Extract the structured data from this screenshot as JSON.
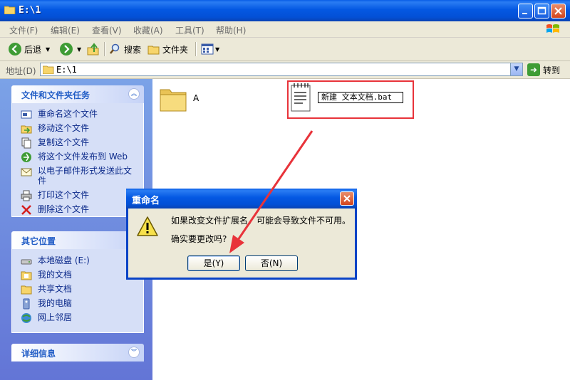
{
  "window": {
    "title": "E:\\1"
  },
  "menu": [
    "文件(F)",
    "编辑(E)",
    "查看(V)",
    "收藏(A)",
    "工具(T)",
    "帮助(H)"
  ],
  "toolbar": {
    "back": "后退",
    "search": "搜索",
    "folders": "文件夹"
  },
  "address": {
    "label": "地址(D)",
    "value": "E:\\1",
    "go": "转到"
  },
  "tasks": {
    "title": "文件和文件夹任务",
    "items": [
      "重命名这个文件",
      "移动这个文件",
      "复制这个文件",
      "将这个文件发布到 Web",
      "以电子邮件形式发送此文件",
      "打印这个文件",
      "删除这个文件"
    ]
  },
  "places": {
    "title": "其它位置",
    "items": [
      "本地磁盘 (E:)",
      "我的文档",
      "共享文档",
      "我的电脑",
      "网上邻居"
    ]
  },
  "details": {
    "title": "详细信息"
  },
  "files": {
    "folder_name": "A",
    "rename_value": "新建 文本文档.bat"
  },
  "dialog": {
    "title": "重命名",
    "message1": "如果改变文件扩展名，可能会导致文件不可用。",
    "message2": "确实要更改吗?",
    "yes": "是(Y)",
    "no": "否(N)"
  },
  "colors": {
    "annotation_red": "#e8333a",
    "xp_blue": "#0458e2"
  }
}
